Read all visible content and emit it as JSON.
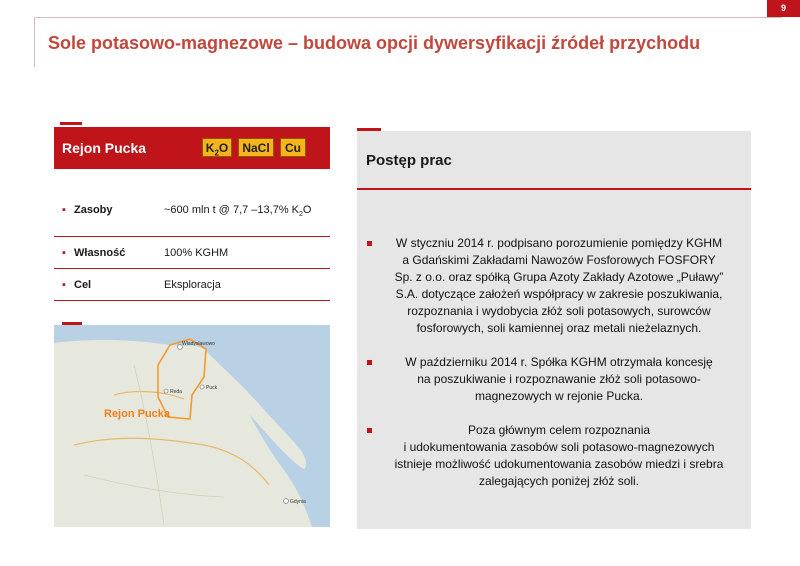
{
  "header": {
    "page_number": "9",
    "title": "Sole potasowo-magnezowe – budowa opcji dywersyfikacji źródeł przychodu"
  },
  "region": {
    "name": "Rejon Pucka",
    "chips": [
      {
        "main": "K",
        "sub": "2",
        "tail": "O"
      },
      {
        "main": "NaCl"
      },
      {
        "main": "Cu"
      }
    ]
  },
  "info": [
    {
      "label": "Zasoby",
      "value_pre": "~600 mln t @ 7,7 –13,7% K",
      "value_sub": "2",
      "value_post": "O"
    },
    {
      "label": "Własność",
      "value_pre": "100% KGHM"
    },
    {
      "label": "Cel",
      "value_pre": "Eksploracja"
    }
  ],
  "map": {
    "region_label": "Rejon Pucka",
    "places": [
      "Władysławowo",
      "Gdynia",
      "Puck",
      "Reda"
    ]
  },
  "progress": {
    "heading": "Postęp prac",
    "bullets": [
      {
        "lines": [
          "W styczniu 2014 r. podpisano porozumienie pomiędzy KGHM",
          "a Gdańskimi Zakładami Nawozów Fosforowych FOSFORY",
          "Sp. z o.o. oraz spółką Grupa Azoty Zakłady Azotowe „Puławy”",
          "S.A. dotyczące założeń współpracy w zakresie poszukiwania,",
          "rozpoznania i wydobycia złóż soli potasowych, surowców",
          "fosforowych, soli kamiennej oraz metali nieżelaznych."
        ]
      },
      {
        "lines": [
          "W październiku 2014 r. Spółka KGHM otrzymała koncesję",
          "na poszukiwanie i rozpoznawanie złóż soli potasowo-",
          "magnezowych w rejonie Pucka."
        ]
      },
      {
        "lines": [
          "Poza głównym celem rozpoznania",
          "i udokumentowania zasobów soli potasowo-magnezowych",
          "istnieje możliwość udokumentowania zasobów miedzi i srebra",
          "zalegających poniżej złóż soli."
        ]
      }
    ]
  },
  "colors": {
    "accent": "#c0141b",
    "title": "#c2473c",
    "chip": "#f5b31c",
    "panel_bg": "#e6e6e6"
  }
}
